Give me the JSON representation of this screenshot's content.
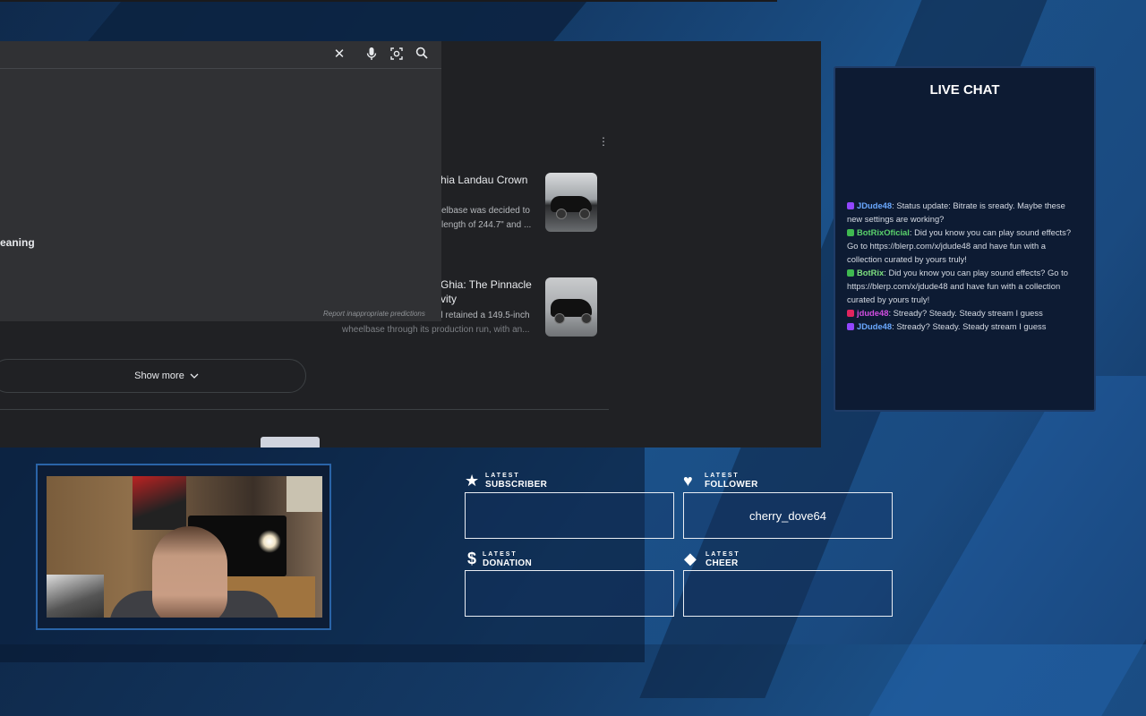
{
  "browser": {
    "suggestion_text": "eaning",
    "report_link": "Report inappropriate predictions",
    "results": [
      {
        "title_line1": "hia Landau Crown",
        "title_line2": "",
        "snippet_line1": "elbase was decided to",
        "snippet_line2": "length of 244.7\" and ..."
      },
      {
        "title_line1": "Ghia: The Pinnacle",
        "title_line2": "vity",
        "snippet_line1": "al retained a 149.5-inch",
        "snippet_line2": "wheelbase through its production run, with an..."
      }
    ],
    "show_more": "Show more"
  },
  "chat": {
    "title": "LIVE CHAT",
    "messages": [
      {
        "user": "JDude48",
        "user_color": "#6aa8ff",
        "badge_color": "#9146ff",
        "text": "Status update: Bitrate is sready. Maybe these new settings are working?"
      },
      {
        "user": "BotRixOficial",
        "user_color": "#5ad16b",
        "badge_color": "#3fb950",
        "text": "Did you know you can play sound effects? Go to https://blerp.com/x/jdude48 and have fun with a collection curated by yours truly!"
      },
      {
        "user": "BotRix",
        "user_color": "#7ee07f",
        "badge_color": "#3fb950",
        "text": "Did you know you can play sound effects? Go to https://blerp.com/x/jdude48 and have fun with a collection curated by yours truly!"
      },
      {
        "user": "jdude48",
        "user_color": "#d14ee0",
        "badge_color": "#e0245e",
        "text": "Stready? Steady. Steady stream I guess"
      },
      {
        "user": "JDude48",
        "user_color": "#6aa8ff",
        "badge_color": "#9146ff",
        "text": "Stready? Steady. Steady stream I guess"
      }
    ]
  },
  "alerts": {
    "subscriber": {
      "small": "LATEST",
      "big": "SUBSCRIBER",
      "value": ""
    },
    "follower": {
      "small": "LATEST",
      "big": "FOLLOWER",
      "value": "cherry_dove64"
    },
    "donation": {
      "small": "LATEST",
      "big": "DONATION",
      "value": ""
    },
    "cheer": {
      "small": "LATEST",
      "big": "CHEER",
      "value": ""
    }
  }
}
